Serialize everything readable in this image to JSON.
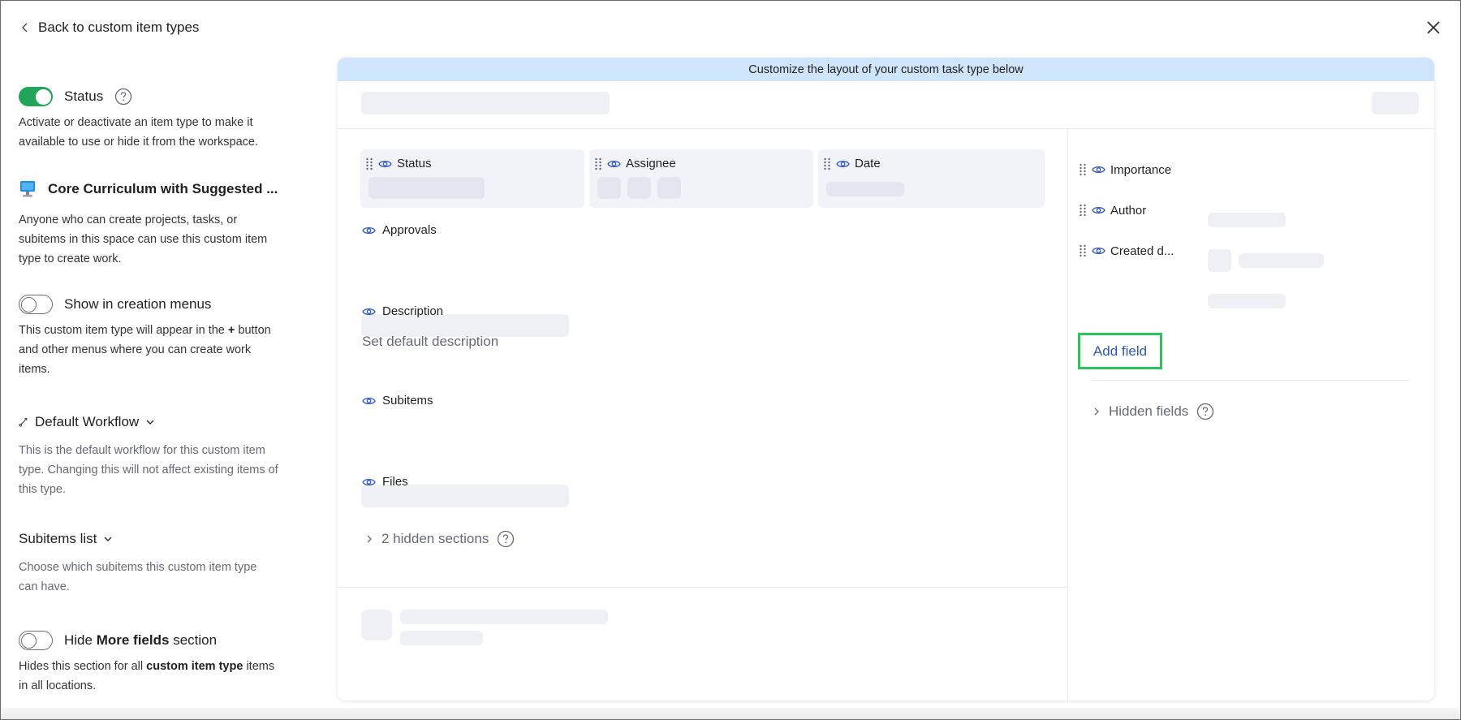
{
  "header": {
    "back_label": "Back to custom item types"
  },
  "sidebar": {
    "status": {
      "label": "Status",
      "enabled": true,
      "description": "Activate or deactivate an item type to make it available to use or hide it from the workspace."
    },
    "item_type": {
      "name": "Core Curriculum with Suggested ...",
      "description": "Anyone who can create projects, tasks, or subitems in this space can use this custom item type to create work."
    },
    "creation_menus": {
      "label": "Show in creation menus",
      "enabled": false,
      "description_before": "This custom item type will appear in the",
      "description_plus": "+",
      "description_after": "button and other menus where you can create work items."
    },
    "workflow": {
      "label": "Default Workflow",
      "description": "This is the default workflow for this custom item type. Changing this will not affect existing items of this type."
    },
    "subitems_list": {
      "label": "Subitems list",
      "description": "Choose which subitems this custom item type can have."
    },
    "hide_more_fields": {
      "label_before": "Hide",
      "label_bold": "More fields",
      "label_after": "section",
      "enabled": false,
      "description_before": "Hides this section for all",
      "description_bold": "custom item type",
      "description_after": "items in all locations."
    }
  },
  "card": {
    "banner": "Customize the layout of your custom task type below",
    "top_fields": [
      {
        "label": "Status"
      },
      {
        "label": "Assignee"
      },
      {
        "label": "Date"
      }
    ],
    "sections": {
      "approvals": "Approvals",
      "description": "Description",
      "description_placeholder": "Set default description",
      "subitems": "Subitems",
      "files": "Files"
    },
    "hidden_sections": "2 hidden sections",
    "right_fields": [
      {
        "label": "Importance"
      },
      {
        "label": "Author"
      },
      {
        "label": "Created d..."
      }
    ],
    "add_field": "Add field",
    "hidden_fields": "Hidden fields"
  },
  "colors": {
    "toggle_on": "#22a55b",
    "banner_bg": "#cfe5fb",
    "link_blue": "#2f57b9",
    "highlight_green": "#2bc45c",
    "skeleton": "#eef0f6"
  }
}
